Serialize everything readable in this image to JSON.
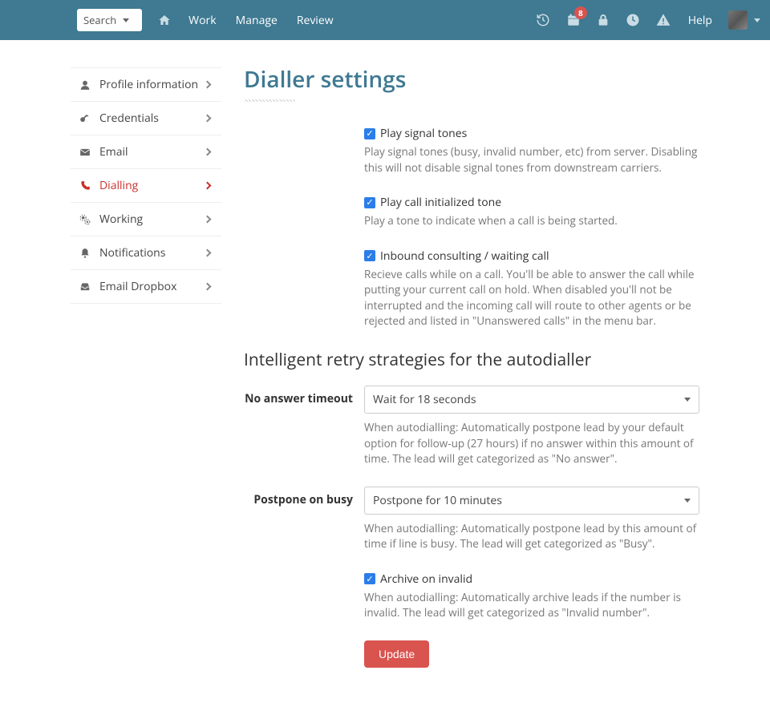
{
  "topnav": {
    "search_label": "Search",
    "links": [
      "Work",
      "Manage",
      "Review"
    ],
    "badge_count": "8",
    "help_label": "Help"
  },
  "sidebar": {
    "items": [
      {
        "label": "Profile information"
      },
      {
        "label": "Credentials"
      },
      {
        "label": "Email"
      },
      {
        "label": "Dialling"
      },
      {
        "label": "Working"
      },
      {
        "label": "Notifications"
      },
      {
        "label": "Email Dropbox"
      }
    ]
  },
  "page": {
    "title": "Dialler settings",
    "section_title": "Intelligent retry strategies for the autodialler",
    "update_button": "Update"
  },
  "options": {
    "signal_tones": {
      "label": "Play signal tones",
      "help": "Play signal tones (busy, invalid number, etc) from server. Disabling this will not disable signal tones from downstream carriers."
    },
    "initialized_tone": {
      "label": "Play call initialized tone",
      "help": "Play a tone to indicate when a call is being started."
    },
    "inbound_consulting": {
      "label": "Inbound consulting / waiting call",
      "help": "Recieve calls while on a call. You'll be able to answer the call while putting your current call on hold. When disabled you'll not be interrupted and the incoming call will route to other agents or be rejected and listed in \"Unanswered calls\" in the menu bar."
    }
  },
  "retry": {
    "no_answer": {
      "label": "No answer timeout",
      "value": "Wait for 18 seconds",
      "help": "When autodialling: Automatically postpone lead by your default option for follow-up (27 hours) if no answer within this amount of time. The lead will get categorized as \"No answer\"."
    },
    "postpone_busy": {
      "label": "Postpone on busy",
      "value": "Postpone for 10 minutes",
      "help": "When autodialling: Automatically postpone lead by this amount of time if line is busy. The lead will get categorized as \"Busy\"."
    },
    "archive_invalid": {
      "label": "Archive on invalid",
      "help": "When autodialling: Automatically archive leads if the number is invalid. The lead will get categorized as \"Invalid number\"."
    }
  }
}
